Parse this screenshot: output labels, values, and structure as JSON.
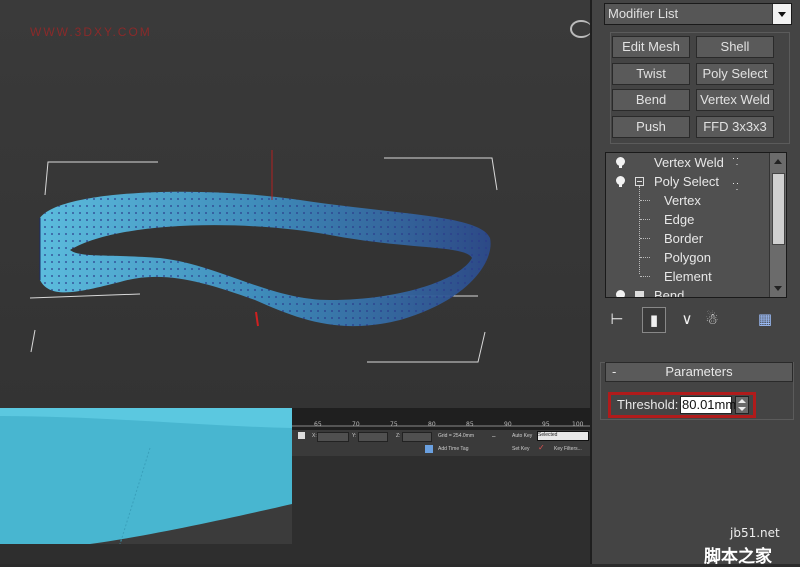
{
  "viewport": {
    "watermark": "WWW.3DXY.COM"
  },
  "timeline": {
    "ticks": [
      "65",
      "70",
      "75",
      "80",
      "85",
      "90",
      "95",
      "100"
    ]
  },
  "statusbar": {
    "x_label": "X:",
    "y_label": "Y:",
    "z_label": "Z:",
    "grid_text": "Grid = 254.0mm",
    "auto_key": "Auto Key",
    "selected": "Selected",
    "add_time_tag": "Add Time Tag",
    "set_key": "Set Key",
    "key_filters": "Key Filters..."
  },
  "command_panel": {
    "modifier_list": "Modifier List",
    "modifier_buttons": [
      "Edit Mesh",
      "Shell",
      "Twist",
      "Poly Select",
      "Bend",
      "Vertex Weld",
      "Push",
      "FFD 3x3x3"
    ],
    "stack": {
      "vertex_weld": "Vertex Weld",
      "poly_select": "Poly Select",
      "sub_objects": [
        "Vertex",
        "Edge",
        "Border",
        "Polygon",
        "Element"
      ],
      "bend": "Bend"
    },
    "parameters": {
      "header": "Parameters",
      "collapse": "-",
      "threshold_label": "Threshold:",
      "threshold_value": "80.01mm"
    }
  },
  "watermark_br": {
    "site": "jb51.net",
    "name": "脚本之家"
  },
  "colors": {
    "accent_red": "#b01b1b",
    "mesh_blue": "#4fb2d6"
  }
}
